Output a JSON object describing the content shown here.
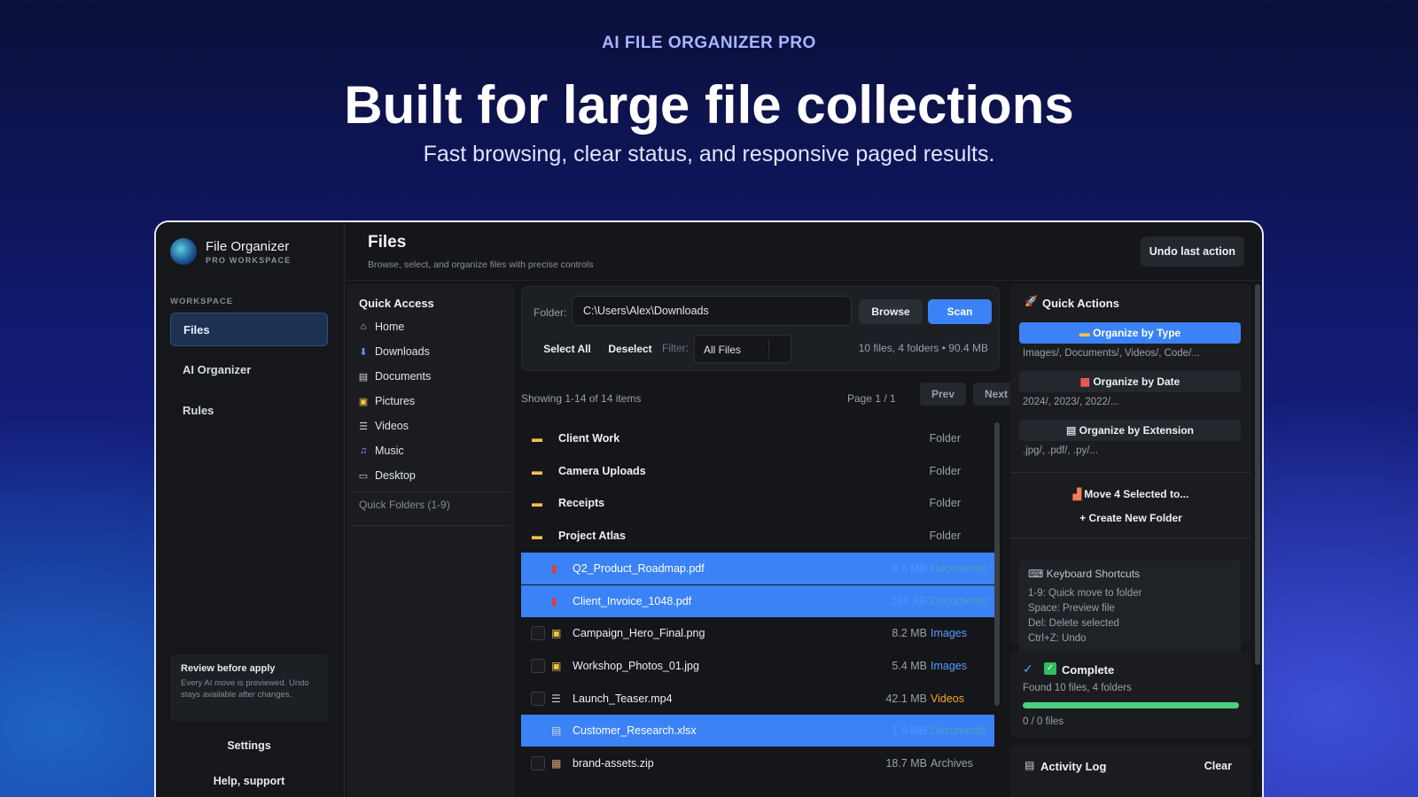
{
  "hero": {
    "eyebrow": "AI FILE ORGANIZER PRO",
    "title": "Built for large file collections",
    "subtitle": "Fast browsing, clear status, and responsive paged results."
  },
  "brand": {
    "name": "File Organizer",
    "sub": "PRO WORKSPACE"
  },
  "sidebar": {
    "section": "WORKSPACE",
    "items": [
      {
        "label": "Files"
      },
      {
        "label": "AI Organizer"
      },
      {
        "label": "Rules"
      }
    ],
    "review_title": "Review before apply",
    "review_desc": "Every AI move is previewed. Undo stays available after changes.",
    "settings": "Settings",
    "help": "Help, support"
  },
  "header": {
    "title": "Files",
    "subtitle": "Browse, select, and organize files with precise controls",
    "undo": "Undo last action"
  },
  "quick_access": {
    "title": "Quick Access",
    "items": [
      {
        "label": "Home",
        "icon": "home-icon"
      },
      {
        "label": "Downloads",
        "icon": "downloads-icon"
      },
      {
        "label": "Documents",
        "icon": "documents-icon"
      },
      {
        "label": "Pictures",
        "icon": "pictures-icon"
      },
      {
        "label": "Videos",
        "icon": "videos-icon"
      },
      {
        "label": "Music",
        "icon": "music-icon"
      },
      {
        "label": "Desktop",
        "icon": "desktop-icon"
      }
    ],
    "folders_label": "Quick Folders (1-9)"
  },
  "toolbar": {
    "folder_label": "Folder:",
    "folder_value": "C:\\Users\\Alex\\Downloads",
    "browse": "Browse",
    "scan": "Scan",
    "select_all": "Select All",
    "deselect": "Deselect",
    "filter_label": "Filter:",
    "filter_value": "All Files",
    "stats": "10 files, 4 folders • 90.4 MB"
  },
  "pager": {
    "showing": "Showing 1-14 of 14 items",
    "page": "Page 1 / 1",
    "prev": "Prev",
    "next": "Next"
  },
  "files": [
    {
      "name": "Client Work",
      "size": "",
      "type": "Folder",
      "kind": "folder",
      "selected": false
    },
    {
      "name": "Camera Uploads",
      "size": "",
      "type": "Folder",
      "kind": "folder",
      "selected": false
    },
    {
      "name": "Receipts",
      "size": "",
      "type": "Folder",
      "kind": "folder",
      "selected": false
    },
    {
      "name": "Project Atlas",
      "size": "",
      "type": "Folder",
      "kind": "folder",
      "selected": false
    },
    {
      "name": "Q2_Product_Roadmap.pdf",
      "size": "4.8 MB",
      "type": "Documents",
      "kind": "pdf",
      "selected": true
    },
    {
      "name": "Client_Invoice_1048.pdf",
      "size": "286 KB",
      "type": "Documents",
      "kind": "pdf",
      "selected": true
    },
    {
      "name": "Campaign_Hero_Final.png",
      "size": "8.2 MB",
      "type": "Images",
      "kind": "image",
      "selected": false
    },
    {
      "name": "Workshop_Photos_01.jpg",
      "size": "5.4 MB",
      "type": "Images",
      "kind": "image",
      "selected": false
    },
    {
      "name": "Launch_Teaser.mp4",
      "size": "42.1 MB",
      "type": "Videos",
      "kind": "video",
      "selected": false
    },
    {
      "name": "Customer_Research.xlsx",
      "size": "1.6 MB",
      "type": "Documents",
      "kind": "sheet",
      "selected": true
    },
    {
      "name": "brand-assets.zip",
      "size": "18.7 MB",
      "type": "Archives",
      "kind": "zip",
      "selected": false
    }
  ],
  "type_colors": {
    "Images": "#5b9cff",
    "Videos": "#f5a623",
    "Archives": "#9aa0a8",
    "Documents": "#4ccf7f"
  },
  "quick_actions": {
    "title": "Quick Actions",
    "by_type": "Organize by Type",
    "by_type_hint": "Images/, Documents/, Videos/, Code/...",
    "by_date": "Organize by Date",
    "by_date_hint": "2024/, 2023/, 2022/...",
    "by_ext": "Organize by Extension",
    "by_ext_hint": ".jpg/, .pdf/, .py/...",
    "move": "Move 4 Selected to...",
    "create": "Create New Folder"
  },
  "shortcuts": {
    "title": "Keyboard Shortcuts",
    "lines": [
      "1-9: Quick move to folder",
      "Space: Preview file",
      "Del: Delete selected",
      "Ctrl+Z: Undo"
    ]
  },
  "status": {
    "title": "Complete",
    "found": "Found 10 files, 4 folders",
    "count": "0 / 0 files",
    "progress": 1.0
  },
  "activity": {
    "title": "Activity Log",
    "clear": "Clear"
  }
}
